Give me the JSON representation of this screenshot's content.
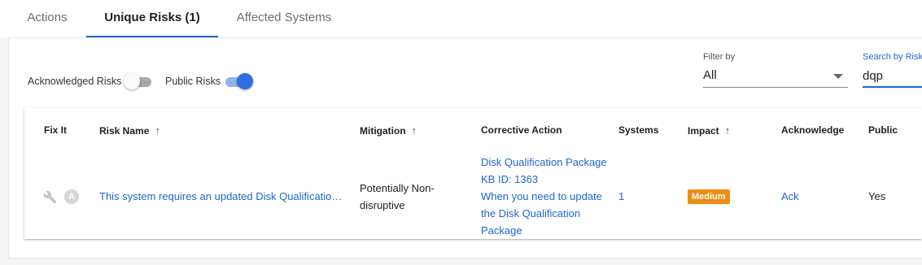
{
  "tabs": [
    {
      "label": "Actions",
      "active": false
    },
    {
      "label": "Unique Risks (1)",
      "active": true
    },
    {
      "label": "Affected Systems",
      "active": false
    }
  ],
  "toggles": {
    "acknowledged": {
      "label": "Acknowledged Risks",
      "on": false
    },
    "public": {
      "label": "Public Risks",
      "on": true
    }
  },
  "filter": {
    "label": "Filter by",
    "value": "All"
  },
  "search": {
    "label": "Search by Risk",
    "value": "dqp"
  },
  "table": {
    "headers": {
      "fix_it": "Fix It",
      "risk_name": "Risk Name",
      "mitigation": "Mitigation",
      "corrective_action": "Corrective Action",
      "systems": "Systems",
      "impact": "Impact",
      "acknowledge": "Acknowledge",
      "public": "Public"
    },
    "sort_glyph": "↑",
    "row": {
      "fix_icon": "wrench-icon",
      "fix_badge": "A",
      "risk_name": "This system requires an updated Disk Qualificatio…",
      "mitigation_line1": "Potentially Non-",
      "mitigation_line2": "disruptive",
      "corrective_lines": [
        "Disk Qualification Package",
        "KB ID: 1363",
        "When you need to update",
        "the Disk Qualification",
        "Package"
      ],
      "systems": "1",
      "impact": "Medium",
      "acknowledge": "Ack",
      "public": "Yes"
    }
  },
  "colors": {
    "accent": "#1e66d0",
    "impact_medium": "#ef8c12"
  }
}
